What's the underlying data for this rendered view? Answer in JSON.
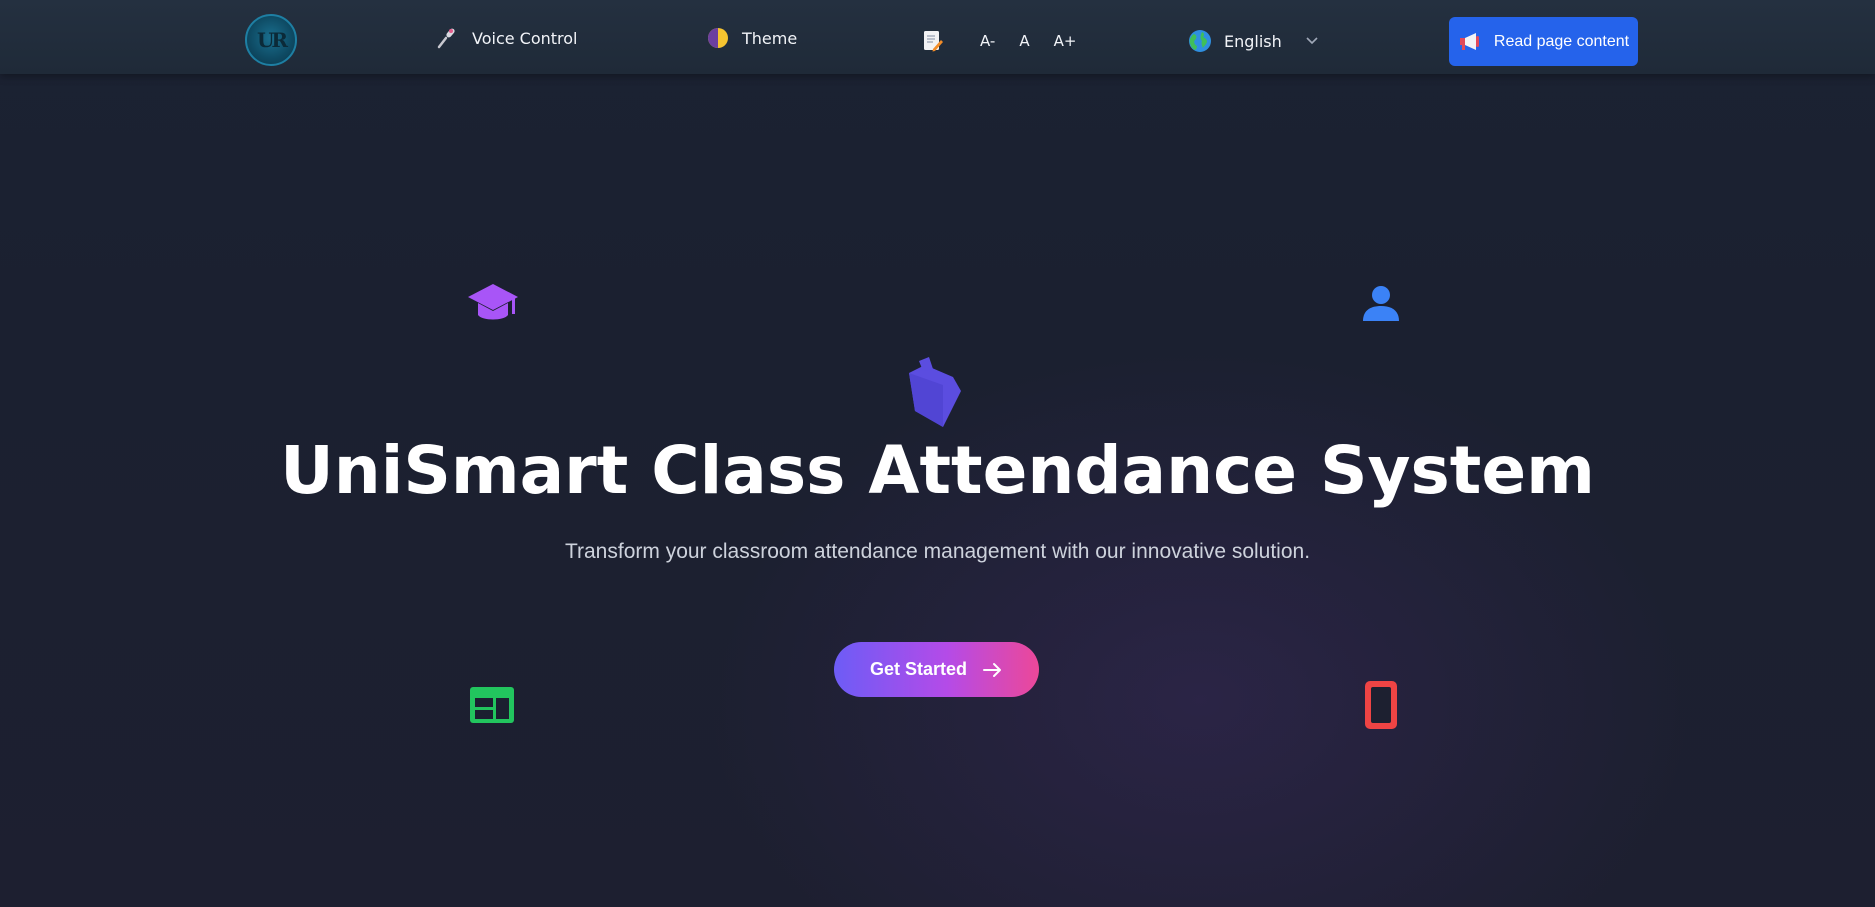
{
  "header": {
    "logo_text": "UR",
    "voice_label": "Voice Control",
    "theme_label": "Theme",
    "font_decrease": "A-",
    "font_reset": "A",
    "font_increase": "A+",
    "language_selected": "English",
    "read_button_label": "Read page content"
  },
  "hero": {
    "title": "UniSmart Class Attendance System",
    "subtitle": "Transform your classroom attendance management with our innovative solution.",
    "cta_label": "Get Started"
  },
  "icons": {
    "voice": "microphone-icon",
    "theme": "theme-toggle-icon",
    "font": "document-edit-icon",
    "language": "globe-icon",
    "read": "megaphone-icon",
    "floating": [
      "graduation-cap-icon",
      "user-icon",
      "cube-icon",
      "id-card-icon",
      "mobile-phone-icon"
    ]
  },
  "colors": {
    "accent_blue": "#2563eb",
    "cap_purple": "#a855f7",
    "user_blue": "#3b82f6",
    "cube_indigo": "#5b4de0",
    "card_green": "#22c55e",
    "phone_red": "#ef4444",
    "cta_start": "#6d5cf6",
    "cta_end": "#ec4899"
  }
}
